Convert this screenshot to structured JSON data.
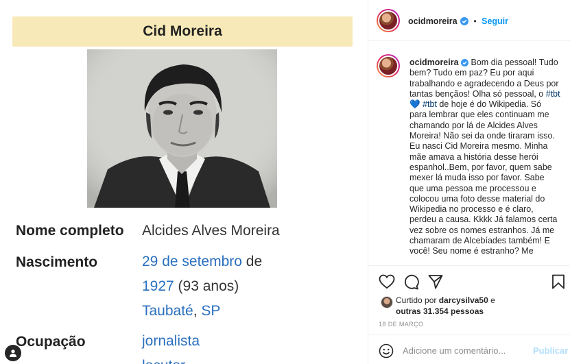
{
  "post_image": {
    "wiki": {
      "title": "Cid Moreira",
      "rows": [
        {
          "label": "Nome completo",
          "value": "Alcides Alves Moreira"
        },
        {
          "label": "Nascimento",
          "date_link": "29 de setembro",
          "date_rest": " de",
          "year_link": "1927",
          "age": " (93 anos)",
          "city_link": "Taubaté",
          "sep": ", ",
          "state_link": "SP"
        },
        {
          "label": "Ocupação",
          "value1": "jornalista",
          "value2": "locutor"
        }
      ]
    }
  },
  "header": {
    "username": "ocidmoreira",
    "separator": "•",
    "follow_label": "Seguir"
  },
  "caption": {
    "username": "ocidmoreira",
    "text_1": " Bom dia pessoal! Tudo bem? Tudo em paz? Eu por aqui trabalhando e agradecendo a Deus por tantas bençãos! Olha só pessoal, o ",
    "hashtag_1": "#tbt",
    "heart": "💙",
    "hashtag_2": "#tbt",
    "text_2": " de hoje é do Wikipedia. Só para lembrar que eles continuam me chamando por lá de Alcides Alves Moreira! Não sei da onde tiraram isso. Eu nasci Cid Moreira mesmo. Minha mãe amava a história desse herói espanhol..Bem, por favor, quem sabe mexer lá muda isso por favor. Sabe que uma pessoa me processou e colocou uma foto desse material do Wikipedia no processo e é claro, perdeu a causa. Kkkk Já falamos certa vez sobre os nomes estranhos. Já me chamaram de Alcebíades também! E você! Seu nome é estranho? Me"
  },
  "actions": {
    "liked_by_prefix": "Curtido por ",
    "liked_by_user": "darcysilva50",
    "liked_by_mid": " e",
    "liked_by_others": "outras 31.354 pessoas",
    "date": "18 DE MARÇO"
  },
  "comment": {
    "placeholder": "Adicione um comentário...",
    "publish_label": "Publicar"
  },
  "colors": {
    "accent": "#0095f6",
    "hashtag": "#00376b",
    "wiki_link": "#2a6fbf",
    "wiki_title_bg": "#f8eab8"
  },
  "icons": [
    "verified-badge-icon",
    "heart-icon",
    "comment-icon",
    "share-icon",
    "bookmark-icon",
    "emoji-icon",
    "user-icon"
  ]
}
